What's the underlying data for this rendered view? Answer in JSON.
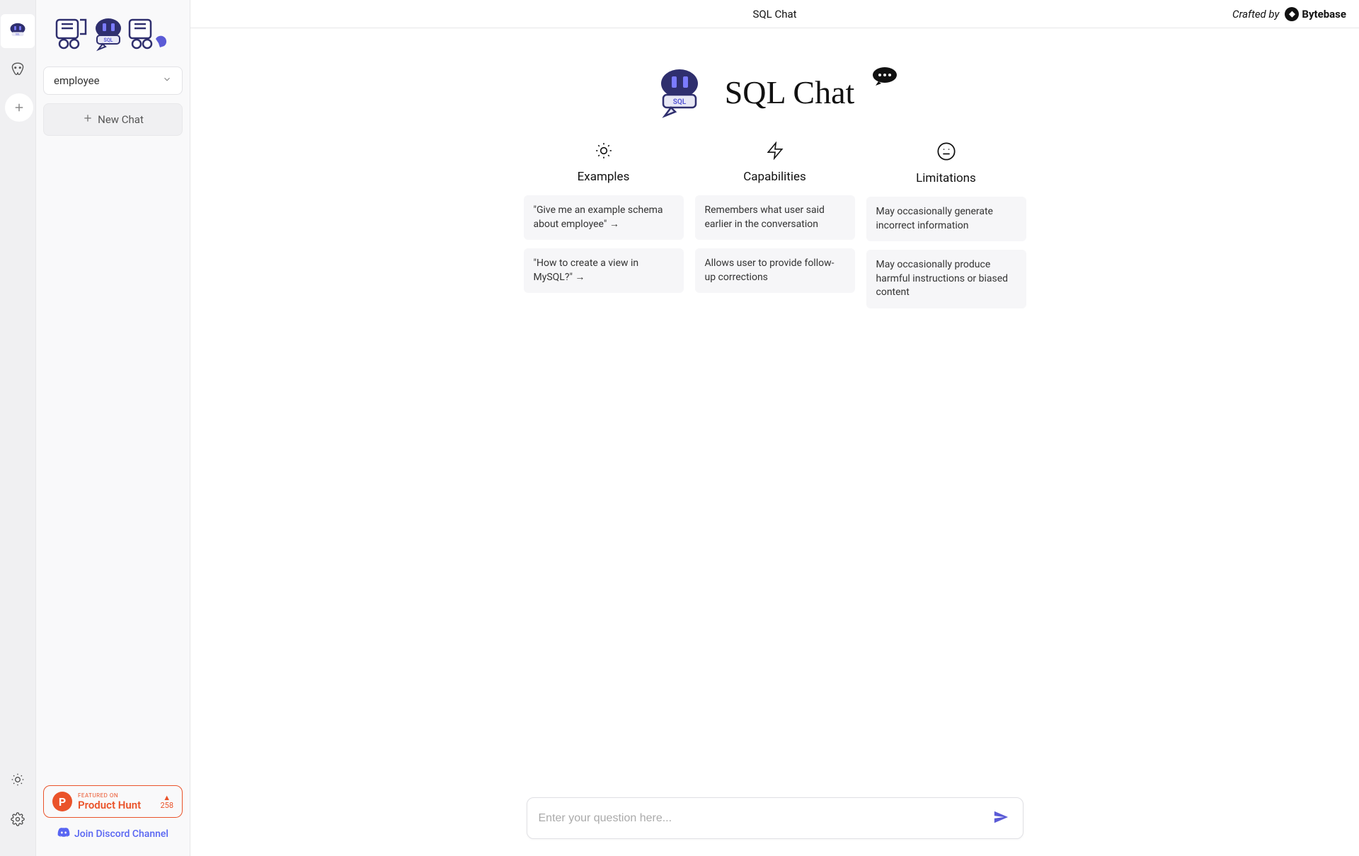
{
  "header": {
    "title": "SQL Chat",
    "crafted_by": "Crafted by",
    "brand": "Bytebase"
  },
  "sidebar": {
    "db_selected": "employee",
    "new_chat": "New Chat",
    "product_hunt": {
      "featured": "FEATURED ON",
      "name": "Product Hunt",
      "upvotes": "258"
    },
    "discord": "Join Discord Channel"
  },
  "hero": {
    "title": "SQL Chat"
  },
  "columns": {
    "examples": {
      "title": "Examples",
      "items": [
        "\"Give me an example schema about employee\" →",
        "\"How to create a view in MySQL?\" →"
      ]
    },
    "capabilities": {
      "title": "Capabilities",
      "items": [
        "Remembers what user said earlier in the conversation",
        "Allows user to provide follow-up corrections"
      ]
    },
    "limitations": {
      "title": "Limitations",
      "items": [
        "May occasionally generate incorrect information",
        "May occasionally produce harmful instructions or biased content"
      ]
    }
  },
  "input": {
    "placeholder": "Enter your question here..."
  }
}
